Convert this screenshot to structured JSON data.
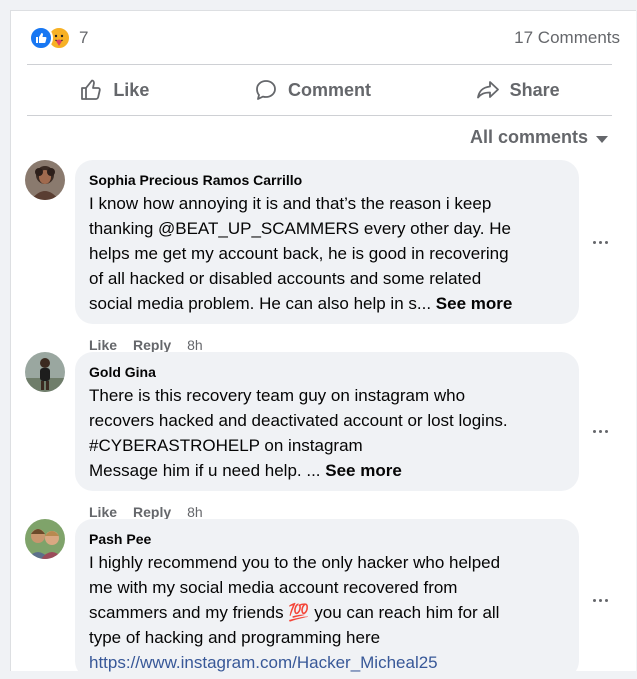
{
  "reactions": {
    "count": "7",
    "comments_count": "17 Comments",
    "icons": [
      "like-icon",
      "care-icon"
    ]
  },
  "actions": [
    {
      "label": "Like",
      "icon": "thumbs-up-icon"
    },
    {
      "label": "Comment",
      "icon": "speech-bubble-icon"
    },
    {
      "label": "Share",
      "icon": "share-arrow-icon"
    }
  ],
  "filter": {
    "label": "All comments",
    "icon": "caret-down-icon"
  },
  "comments": [
    {
      "author": "Sophia Precious Ramos Carrillo",
      "lines": [
        "I know how annoying it is and that’s the reason i keep",
        "thanking @BEAT_UP_SCAMMERS every other day. He",
        "helps me get my account back, he is good in recovering",
        "of all hacked or disabled accounts and some related",
        "social media problem. He can also help in s..."
      ],
      "see_more": "See more",
      "like": "Like",
      "reply": "Reply",
      "time": "8h"
    },
    {
      "author": "Gold Gina",
      "lines": [
        "There is this recovery team guy on instagram who",
        "recovers hacked and deactivated account or lost logins.",
        "#CYBERASTROHELP on instagram",
        "Message him if u need help. ..."
      ],
      "see_more": "See more",
      "like": "Like",
      "reply": "Reply",
      "time": "8h"
    },
    {
      "author": "Pash Pee",
      "lines": [
        "I highly recommend you to the only hacker who helped",
        "me with my social media account recovered from",
        "scammers and my friends",
        "type of hacking and programming here"
      ],
      "emoji": "💯",
      "line3_tail": " you can reach him for all",
      "link": "https://www.instagram.com/Hacker_Micheal25"
    }
  ],
  "colors": {
    "accent": "#1877f2",
    "secondary_text": "#65676b",
    "bubble": "#f0f2f5",
    "link": "#385898"
  }
}
